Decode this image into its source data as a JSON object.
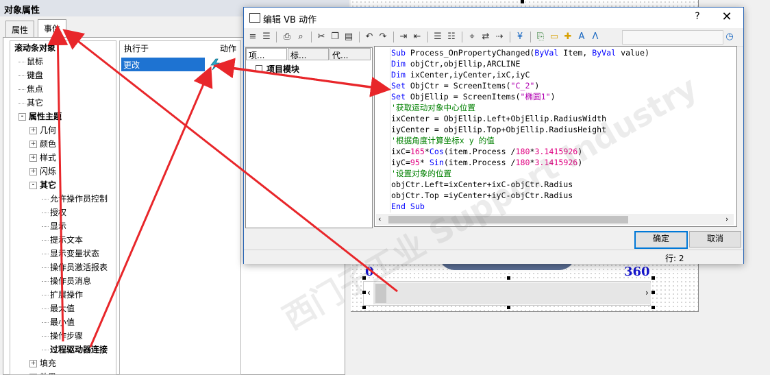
{
  "object_properties": {
    "title": "对象属性",
    "tabs": [
      "属性",
      "事件"
    ],
    "tree": [
      {
        "label": "滚动条对象",
        "level": 0,
        "bold": true,
        "expander": ""
      },
      {
        "label": "鼠标",
        "level": 1,
        "bold": false,
        "expander": ""
      },
      {
        "label": "键盘",
        "level": 1,
        "bold": false,
        "expander": ""
      },
      {
        "label": "焦点",
        "level": 1,
        "bold": false,
        "expander": ""
      },
      {
        "label": "其它",
        "level": 1,
        "bold": false,
        "expander": ""
      },
      {
        "label": "属性主题",
        "level": 1,
        "bold": true,
        "expander": "-"
      },
      {
        "label": "几何",
        "level": 2,
        "bold": false,
        "expander": "+"
      },
      {
        "label": "颜色",
        "level": 2,
        "bold": false,
        "expander": "+"
      },
      {
        "label": "样式",
        "level": 2,
        "bold": false,
        "expander": "+"
      },
      {
        "label": "闪烁",
        "level": 2,
        "bold": false,
        "expander": "+"
      },
      {
        "label": "其它",
        "level": 2,
        "bold": true,
        "expander": "-"
      },
      {
        "label": "允许操作员控制",
        "level": 3,
        "bold": false,
        "expander": ""
      },
      {
        "label": "授权",
        "level": 3,
        "bold": false,
        "expander": ""
      },
      {
        "label": "显示",
        "level": 3,
        "bold": false,
        "expander": ""
      },
      {
        "label": "提示文本",
        "level": 3,
        "bold": false,
        "expander": ""
      },
      {
        "label": "显示变量状态",
        "level": 3,
        "bold": false,
        "expander": ""
      },
      {
        "label": "操作员激活报表",
        "level": 3,
        "bold": false,
        "expander": ""
      },
      {
        "label": "操作员消息",
        "level": 3,
        "bold": false,
        "expander": ""
      },
      {
        "label": "扩展操作",
        "level": 3,
        "bold": false,
        "expander": ""
      },
      {
        "label": "最大值",
        "level": 3,
        "bold": false,
        "expander": ""
      },
      {
        "label": "最小值",
        "level": 3,
        "bold": false,
        "expander": ""
      },
      {
        "label": "操作步骤",
        "level": 3,
        "bold": false,
        "expander": ""
      },
      {
        "label": "过程驱动器连接",
        "level": 3,
        "bold": true,
        "expander": ""
      },
      {
        "label": "填充",
        "level": 2,
        "bold": false,
        "expander": "+"
      },
      {
        "label": "效果",
        "level": 2,
        "bold": false,
        "expander": "+"
      }
    ],
    "grid": {
      "col_executor": "执行于",
      "col_action": "动作",
      "row_value": "更改"
    }
  },
  "canvas": {
    "label_left": "0",
    "label_right": "360"
  },
  "dialog": {
    "title": "编辑 VB 动作",
    "help": "?",
    "close": "✕",
    "left_tabs": [
      "项...",
      "标...",
      "代..."
    ],
    "module_label": "项目模块",
    "ok_label": "确定",
    "cancel_label": "取消",
    "status_line": "行:  2",
    "code_lines": [
      [
        [
          "kw",
          "Sub"
        ],
        [
          "t",
          " Process_OnPropertyChanged("
        ],
        [
          "kw",
          "ByVal"
        ],
        [
          "t",
          " Item, "
        ],
        [
          "kw",
          "ByVal"
        ],
        [
          "t",
          " value)"
        ]
      ],
      [
        [
          "kw",
          "Dim"
        ],
        [
          "t",
          " objCtr,objEllip,ARCLINE"
        ]
      ],
      [
        [
          "kw",
          "Dim"
        ],
        [
          "t",
          " ixCenter,iyCenter,ixC,iyC"
        ]
      ],
      [
        [
          "kw",
          "Set"
        ],
        [
          "t",
          " ObjCtr = ScreenItems("
        ],
        [
          "str",
          "\"C_2\""
        ],
        [
          "t",
          ")"
        ]
      ],
      [
        [
          "kw",
          "Set"
        ],
        [
          "t",
          " ObjEllip = ScreenItems("
        ],
        [
          "str",
          "\"椭圆1\""
        ],
        [
          "t",
          ")"
        ]
      ],
      [
        [
          "cm",
          "'获取运动对象中心位置"
        ]
      ],
      [
        [
          "t",
          "ixCenter = ObjEllip.Left+ObjEllip.RadiusWidth"
        ]
      ],
      [
        [
          "t",
          "iyCenter = objEllip.Top+ObjEllip.RadiusHeight"
        ]
      ],
      [
        [
          "cm",
          "'根据角度计算坐标x y 的值"
        ]
      ],
      [
        [
          "t",
          "ixC="
        ],
        [
          "num",
          "165"
        ],
        [
          "t",
          "*"
        ],
        [
          "kw",
          "Cos"
        ],
        [
          "t",
          "(item.Process /"
        ],
        [
          "num",
          "180"
        ],
        [
          "t",
          "*"
        ],
        [
          "num",
          "3.1415926"
        ],
        [
          "t",
          ")"
        ]
      ],
      [
        [
          "t",
          "iyC="
        ],
        [
          "num",
          "95"
        ],
        [
          "t",
          "* "
        ],
        [
          "kw",
          "Sin"
        ],
        [
          "t",
          "(item.Process /"
        ],
        [
          "num",
          "180"
        ],
        [
          "t",
          "*"
        ],
        [
          "num",
          "3.1415926"
        ],
        [
          "t",
          ")"
        ]
      ],
      [
        [
          "cm",
          "'设置对象的位置"
        ]
      ],
      [
        [
          "t",
          "objCtr.Left=ixCenter+ixC-objCtr.Radius"
        ]
      ],
      [
        [
          "t",
          "objCtr.Top =iyCenter+iyC-objCtr.Radius"
        ]
      ],
      [
        [
          "kw",
          "End Sub"
        ]
      ]
    ]
  },
  "watermark": "西门子工业 Support Industry",
  "colors": {
    "selection": "#1e73d2",
    "keyword": "#0000ff",
    "string": "#b000b0",
    "number": "#e00080",
    "comment": "#008000",
    "annotation_arrow": "#e8262a"
  }
}
